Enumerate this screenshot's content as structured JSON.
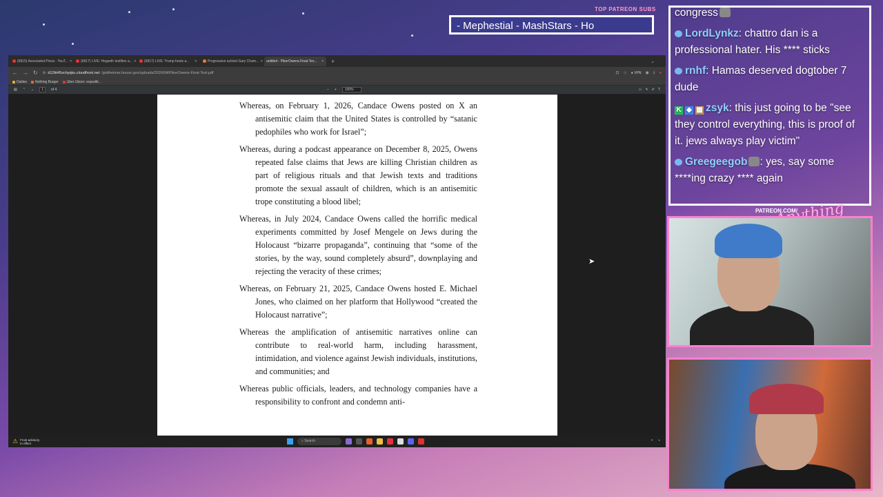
{
  "overlay": {
    "patreon_label": "TOP PATREON SUBS",
    "ticker_text": "- Mephestial - MashStars - Ho",
    "patreon_url": "PATREON.COM/",
    "logo_text": "Anything Else?"
  },
  "browser": {
    "tabs": [
      {
        "label": "(6815) Associated Press - YouT..."
      },
      {
        "label": "(6817) LIVE: Hegseth testifies a..."
      },
      {
        "label": "(6817) LIVE: Trump hosts a..."
      },
      {
        "label": "Progressive activist Gary Cham..."
      },
      {
        "label": "untitled - PikerOwens-Final-Tex..."
      }
    ],
    "active_tab_index": 4,
    "url_host": "d12ttt45xchyqku.cloudfront.net",
    "url_path": "/gottheimer.house.gov/uploads/2026/04/PikerOwens-Final-Text.pdf",
    "vpn_label": "VPN",
    "bookmarks": [
      "Dailies",
      "Nothing Burger",
      "Uber Uboor: expediti..."
    ],
    "pdf": {
      "page_current": "1",
      "page_total": "of 4",
      "zoom": "100%"
    }
  },
  "document": {
    "paragraphs": [
      "Whereas, on February 1, 2026, Candace Owens posted on X an antisemitic claim that the United States is controlled by “satanic pedophiles who work for Israel”;",
      "Whereas, during a podcast appearance on December 8, 2025, Owens repeated false claims that Jews are killing Christian children as part of religious rituals and that Jewish texts and traditions promote the sexual assault of children, which is an antisemitic trope constituting a blood libel;",
      "Whereas, in July 2024, Candace Owens called the horrific medical experiments committed by Josef Mengele on Jews during the Holocaust “bizarre propaganda”, continuing that “some of the stories, by the way, sound completely absurd”, downplaying and rejecting the veracity of these crimes;",
      "Whereas, on February 21, 2025, Candace Owens hosted E. Michael Jones, who claimed on her platform that Hollywood “created the Holocaust narrative”;",
      "Whereas the amplification of antisemitic narratives online can contribute to real-world harm, including harassment, intimidation, and violence against Jewish individuals, institutions, and communities; and",
      "Whereas public officials, leaders, and technology companies have a responsibility to confront and condemn anti-"
    ]
  },
  "taskbar": {
    "weather_line1": "Frost advisory",
    "weather_line2": "In effect",
    "search_label": "Search"
  },
  "chat": {
    "messages": [
      {
        "user": "",
        "text": "congress"
      },
      {
        "user": "LordLynkz",
        "text": ": chattro dan is a professional hater. His **** sticks"
      },
      {
        "user": "rnhf",
        "text": ": Hamas deserved dogtober 7 dude"
      },
      {
        "user": "zsyk",
        "text": ": this just going to be \"see they control everything, this is proof of it. jews always play victim\""
      },
      {
        "user": "Greegeegob",
        "text": ": yes, say some ****ing crazy **** again"
      }
    ]
  },
  "colors": {
    "chat_username": "#8fd0ff",
    "chat_border": "#ffffff",
    "cam_border": "#ff7fd1",
    "patreon_label": "#ff9ccf"
  }
}
